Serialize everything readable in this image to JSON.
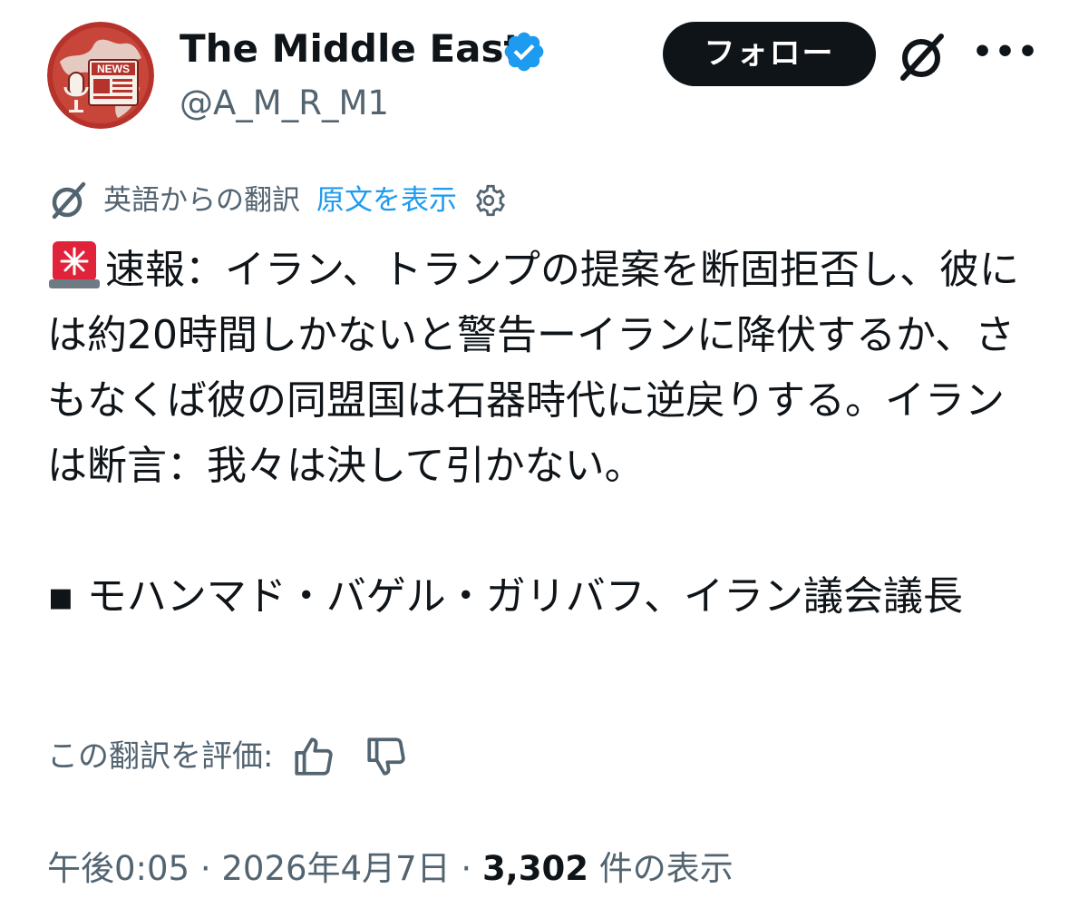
{
  "header": {
    "display_name": "The Middle East",
    "handle": "@A_M_R_M1",
    "follow_label": "フォロー",
    "more_label": "•••",
    "avatar_text": "NEWS"
  },
  "translation": {
    "translated_from": "英語からの翻訳",
    "show_original": "原文を表示"
  },
  "tweet": {
    "paragraph1": "速報：イラン、トランプの提案を断固拒否し、彼には約20時間しかないと警告ーイランに降伏するか、さもなくば彼の同盟国は石器時代に逆戻りする。イランは断言：我々は決して引かない。",
    "paragraph2": "▪ モハンマド・バゲル・ガリバフ、イラン議会議長"
  },
  "rating": {
    "label": "この翻訳を評価:"
  },
  "meta": {
    "time": "午後0:05",
    "sep1": "·",
    "date": "2026年4月7日",
    "sep2": "·",
    "views_count": "3,302",
    "views_label": "件の表示"
  },
  "colors": {
    "verified": "#1d9bf0",
    "link": "#1d9bf0",
    "muted": "#536471",
    "text": "#0f1419",
    "avatar_red": "#b5332b",
    "siren_red": "#e0223a"
  }
}
